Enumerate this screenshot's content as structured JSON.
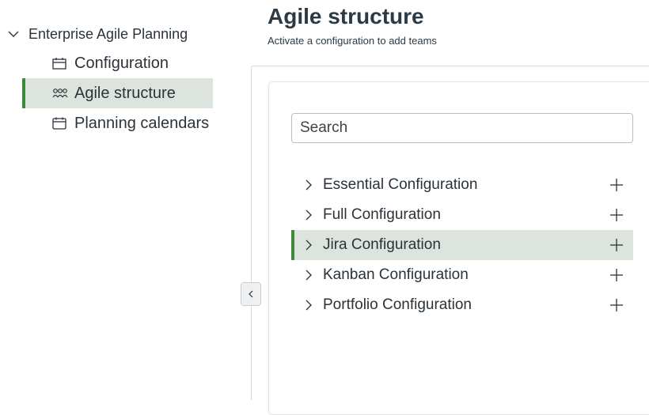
{
  "sidebar": {
    "root_label": "Enterprise Agile Planning",
    "items": [
      {
        "label": "Configuration",
        "icon": "configuration-icon"
      },
      {
        "label": "Agile structure",
        "icon": "team-icon"
      },
      {
        "label": "Planning calendars",
        "icon": "calendar-icon"
      }
    ],
    "active_index": 1
  },
  "header": {
    "title": "Agile structure",
    "subtitle": "Activate a configuration to add teams"
  },
  "search": {
    "placeholder": "Search",
    "value": ""
  },
  "configurations": [
    {
      "label": "Essential Configuration"
    },
    {
      "label": "Full Configuration"
    },
    {
      "label": "Jira Configuration"
    },
    {
      "label": "Kanban Configuration"
    },
    {
      "label": "Portfolio Configuration"
    }
  ],
  "active_configuration_index": 2,
  "colors": {
    "accent": "#3f8a3a",
    "selected_bg": "#dde4dd",
    "text": "#2a333b"
  }
}
